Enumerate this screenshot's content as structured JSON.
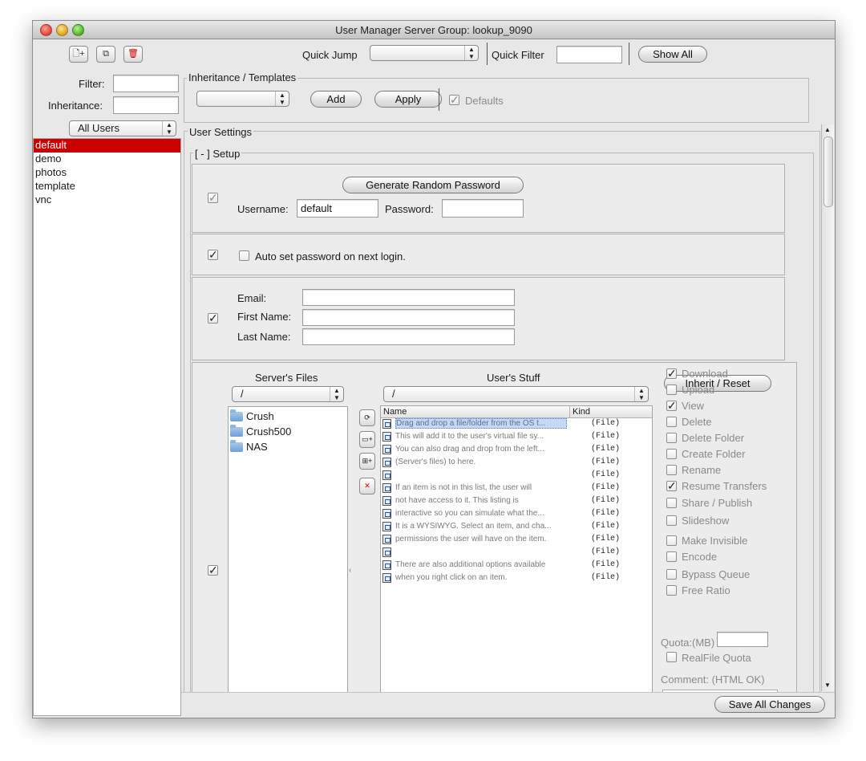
{
  "window": {
    "title": "User Manager Server Group: lookup_9090"
  },
  "toolbar": {
    "quick_jump_label": "Quick Jump",
    "quick_jump_value": "",
    "quick_filter_label": "Quick Filter",
    "quick_filter_value": "",
    "show_all_label": "Show All"
  },
  "left": {
    "filter_label": "Filter:",
    "filter_value": "",
    "inheritance_label": "Inheritance:",
    "inheritance_value": "",
    "user_type": "All Users",
    "users": [
      "default",
      "demo",
      "photos",
      "template",
      "vnc"
    ],
    "selected_user": "default"
  },
  "inheritance": {
    "title": "Inheritance / Templates",
    "template_value": "",
    "add_label": "Add",
    "apply_label": "Apply",
    "defaults_label": "Defaults",
    "defaults_checked": true
  },
  "settings": {
    "title": "User Settings",
    "setup_title": "[ - ] Setup",
    "generate_password_label": "Generate Random Password",
    "username_label": "Username:",
    "username_value": "default",
    "password_label": "Password:",
    "password_value": "",
    "auto_set_label": "Auto set password on next login.",
    "email_label": "Email:",
    "first_name_label": "First Name:",
    "last_name_label": "Last Name:",
    "email_value": "",
    "first_name_value": "",
    "last_name_value": ""
  },
  "files": {
    "server_files_title": "Server's Files",
    "server_path": "/",
    "server_folders": [
      "Crush",
      "Crush500",
      "NAS"
    ],
    "users_stuff_title": "User's Stuff",
    "user_path": "/",
    "col_name": "Name",
    "col_kind": "Kind",
    "items": [
      {
        "name": "Drag and drop a file/folder from the OS t...",
        "kind": "(File)"
      },
      {
        "name": "This will add it to the user's virtual file sy...",
        "kind": "(File)"
      },
      {
        "name": "You can also drag and drop from the left...",
        "kind": "(File)"
      },
      {
        "name": "(Server's files) to here.",
        "kind": "(File)"
      },
      {
        "name": "",
        "kind": "(File)"
      },
      {
        "name": "If an item is not in this list, the user will",
        "kind": "(File)"
      },
      {
        "name": "not have access to it.  This listing is",
        "kind": "(File)"
      },
      {
        "name": "interactive so you can simulate what the...",
        "kind": "(File)"
      },
      {
        "name": "It is a WYSIWYG.  Select an item, and cha...",
        "kind": "(File)"
      },
      {
        "name": "permissions the user will have on the item.",
        "kind": "(File)"
      },
      {
        "name": "",
        "kind": "(File)"
      },
      {
        "name": "There are also additional options available",
        "kind": "(File)"
      },
      {
        "name": "when you right click on an item.",
        "kind": "(File)"
      }
    ]
  },
  "permissions": {
    "inherit_reset_label": "Inherit / Reset",
    "items": [
      {
        "label": "Download",
        "checked": true
      },
      {
        "label": "Upload",
        "checked": false
      },
      {
        "label": "View",
        "checked": true
      },
      {
        "label": "Delete",
        "checked": false
      },
      {
        "label": "Delete Folder",
        "checked": false
      },
      {
        "label": "Create Folder",
        "checked": false
      },
      {
        "label": "Rename",
        "checked": false
      },
      {
        "label": "Resume Transfers",
        "checked": true
      },
      {
        "label": "Share / Publish",
        "checked": false
      },
      {
        "label": "Slideshow",
        "checked": false
      },
      {
        "label": "Make Invisible",
        "checked": false
      },
      {
        "label": "Encode",
        "checked": false
      },
      {
        "label": "Bypass Queue",
        "checked": false
      },
      {
        "label": "Free Ratio",
        "checked": false
      }
    ],
    "quota_label": "Quota:(MB)",
    "quota_value": "",
    "realfile_quota_label": "RealFile Quota",
    "comment_label": "Comment: (HTML OK)"
  },
  "footer": {
    "save_all_label": "Save All Changes"
  },
  "colors": {
    "selection": "#cc0000",
    "window_bg": "#e8e8e8"
  }
}
